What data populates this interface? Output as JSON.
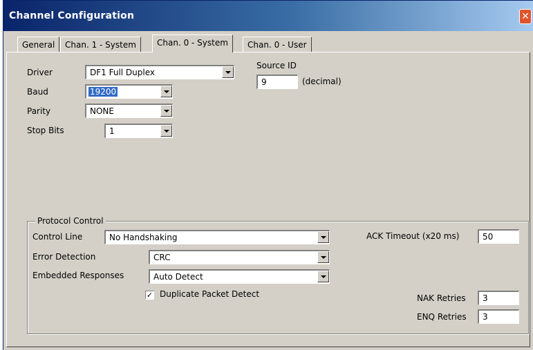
{
  "window": {
    "title": "Channel Configuration",
    "close_glyph": "✕"
  },
  "tabs": [
    {
      "label": "General"
    },
    {
      "label": "Chan. 1 - System"
    },
    {
      "label": "Chan. 0 - System",
      "active": true
    },
    {
      "label": "Chan. 0 - User"
    }
  ],
  "system": {
    "driver": {
      "label": "Driver",
      "value": "DF1 Full Duplex"
    },
    "baud": {
      "label": "Baud",
      "value": "19200"
    },
    "parity": {
      "label": "Parity",
      "value": "NONE"
    },
    "stop_bits": {
      "label": "Stop Bits",
      "value": "1"
    },
    "source_id": {
      "label": "Source ID",
      "value": "9",
      "unit": "(decimal)"
    }
  },
  "protocol": {
    "group_title": "Protocol Control",
    "control_line": {
      "label": "Control Line",
      "value": "No Handshaking"
    },
    "error_detection": {
      "label": "Error Detection",
      "value": "CRC"
    },
    "embedded_responses": {
      "label": "Embedded Responses",
      "value": "Auto Detect"
    },
    "duplicate_packet": {
      "label": "Duplicate Packet Detect",
      "checked": true,
      "check_glyph": "✓"
    },
    "ack_timeout": {
      "label": "ACK Timeout (x20 ms)",
      "value": "50"
    },
    "nak_retries": {
      "label": "NAK Retries",
      "value": "3"
    },
    "enq_retries": {
      "label": "ENQ Retries",
      "value": "3"
    }
  }
}
